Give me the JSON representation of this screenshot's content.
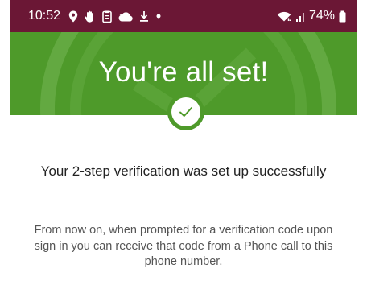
{
  "status_bar": {
    "time": "10:52",
    "battery": "74%",
    "icons": [
      "location-icon",
      "hand-icon",
      "clipboard-icon",
      "cloud-icon",
      "download-icon",
      "dot-icon",
      "wifi-icon",
      "signal-icon",
      "battery-icon"
    ],
    "background": "#6b1735"
  },
  "hero": {
    "title": "You're all set!",
    "background": "#4e9a2a",
    "badge_icon": "checkmark-icon"
  },
  "content": {
    "headline": "Your 2-step verification was set up successfully",
    "body": "From now on, when prompted for a verification code upon sign in you can receive that code from a Phone call to this phone number."
  }
}
